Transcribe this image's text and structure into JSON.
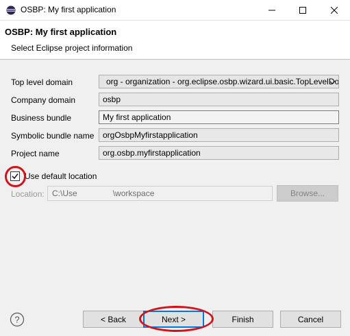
{
  "window": {
    "title": "OSBP: My first application",
    "icon": "eclipse-icon",
    "controls": [
      "minimize-icon",
      "maximize-icon",
      "close-icon"
    ]
  },
  "banner": {
    "title": "OSBP: My first application",
    "description": "Select Eclipse project information"
  },
  "form": {
    "top_level_domain": {
      "label": "Top level domain",
      "value": "org - organization - org.eclipse.osbp.wizard.ui.basic.TopLevelDo"
    },
    "company_domain": {
      "label": "Company domain",
      "value": "osbp"
    },
    "business_bundle": {
      "label": "Business bundle",
      "value": "My first application"
    },
    "symbolic_bundle_name": {
      "label": "Symbolic bundle name",
      "value": "orgOsbpMyfirstapplication"
    },
    "project_name": {
      "label": "Project name",
      "value": "org.osbp.myfirstapplication"
    }
  },
  "default_location": {
    "label": "Use default location",
    "checked": true
  },
  "location": {
    "label": "Location:",
    "value_prefix": "C:\\Use",
    "value_suffix": "\\workspace",
    "browse_label": "Browse..."
  },
  "buttons": {
    "help_icon": "help-icon",
    "back": "< Back",
    "next": "Next >",
    "finish": "Finish",
    "cancel": "Cancel"
  },
  "colors": {
    "highlight_ring": "#d4121a",
    "default_button_border": "#0078d7"
  }
}
